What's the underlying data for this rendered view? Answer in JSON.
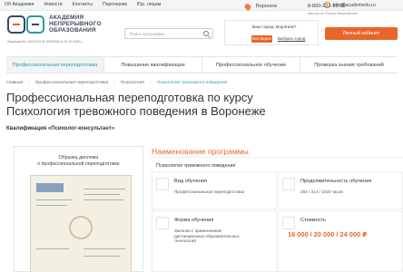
{
  "topbar": {
    "nav": [
      "Об Академии",
      "Новости",
      "Контакты",
      "Партнерам",
      "Юр. лицам"
    ],
    "phone_label": "8-800-222-90-30",
    "email": "info@academedu.ru"
  },
  "header": {
    "brand": [
      "АКАДЕМИЯ",
      "НЕПРЕРЫВНОГО",
      "ОБРАЗОВАНИЯ"
    ],
    "license": "Лицензия № 1619-024 № 0022945 от 21.12.2020 г.",
    "search_placeholder": "Поиск программы",
    "city": "Воронеж",
    "phone": "8-800-222-90-30",
    "free_call": "Звонок по России бесплатный",
    "city_question": "Ваш город: Воронеж?",
    "city_yes": "Всё верно",
    "city_other": "Выбрать город",
    "cabinet_button": "Личный кабинет"
  },
  "menu": [
    {
      "label": "Профессиональная переподготовка",
      "active": true
    },
    {
      "label": "Повышение квалификации",
      "active": false
    },
    {
      "label": "Профессиональное обучение",
      "active": false
    },
    {
      "label": "Проверка знания требований",
      "active": false
    }
  ],
  "breadcrumbs": [
    "Главная",
    "Профессиональная переподготовка",
    "Психология",
    "Психология тревожного поведения"
  ],
  "page_title": "Профессиональная переподготовка по курсу Психология тревожного поведения в Воронеже",
  "qualification": "Квалификация «Психолог-консультант»",
  "diploma_caption": [
    "Образец диплома",
    "о профессиональной переподготовке"
  ],
  "program": {
    "title": "Наименование программы",
    "name": "Психология тревожного поведения"
  },
  "cards": {
    "study_type": {
      "label": "Вид обучения",
      "value": "Профессиональная переподготовка"
    },
    "duration": {
      "label": "Продолжительность обучения",
      "value": "264 / 314 / 1020 часов"
    },
    "form": {
      "label": "Форма обучения",
      "value": [
        "Заочная с применением",
        "дистанционных образовательных",
        "технологий"
      ]
    },
    "cost": {
      "label": "Стоимость",
      "value": "16 000 / 20 000 / 24 000 ₽"
    }
  },
  "colors": {
    "accent": "#e8662a",
    "teal": "#2a9aa6"
  }
}
